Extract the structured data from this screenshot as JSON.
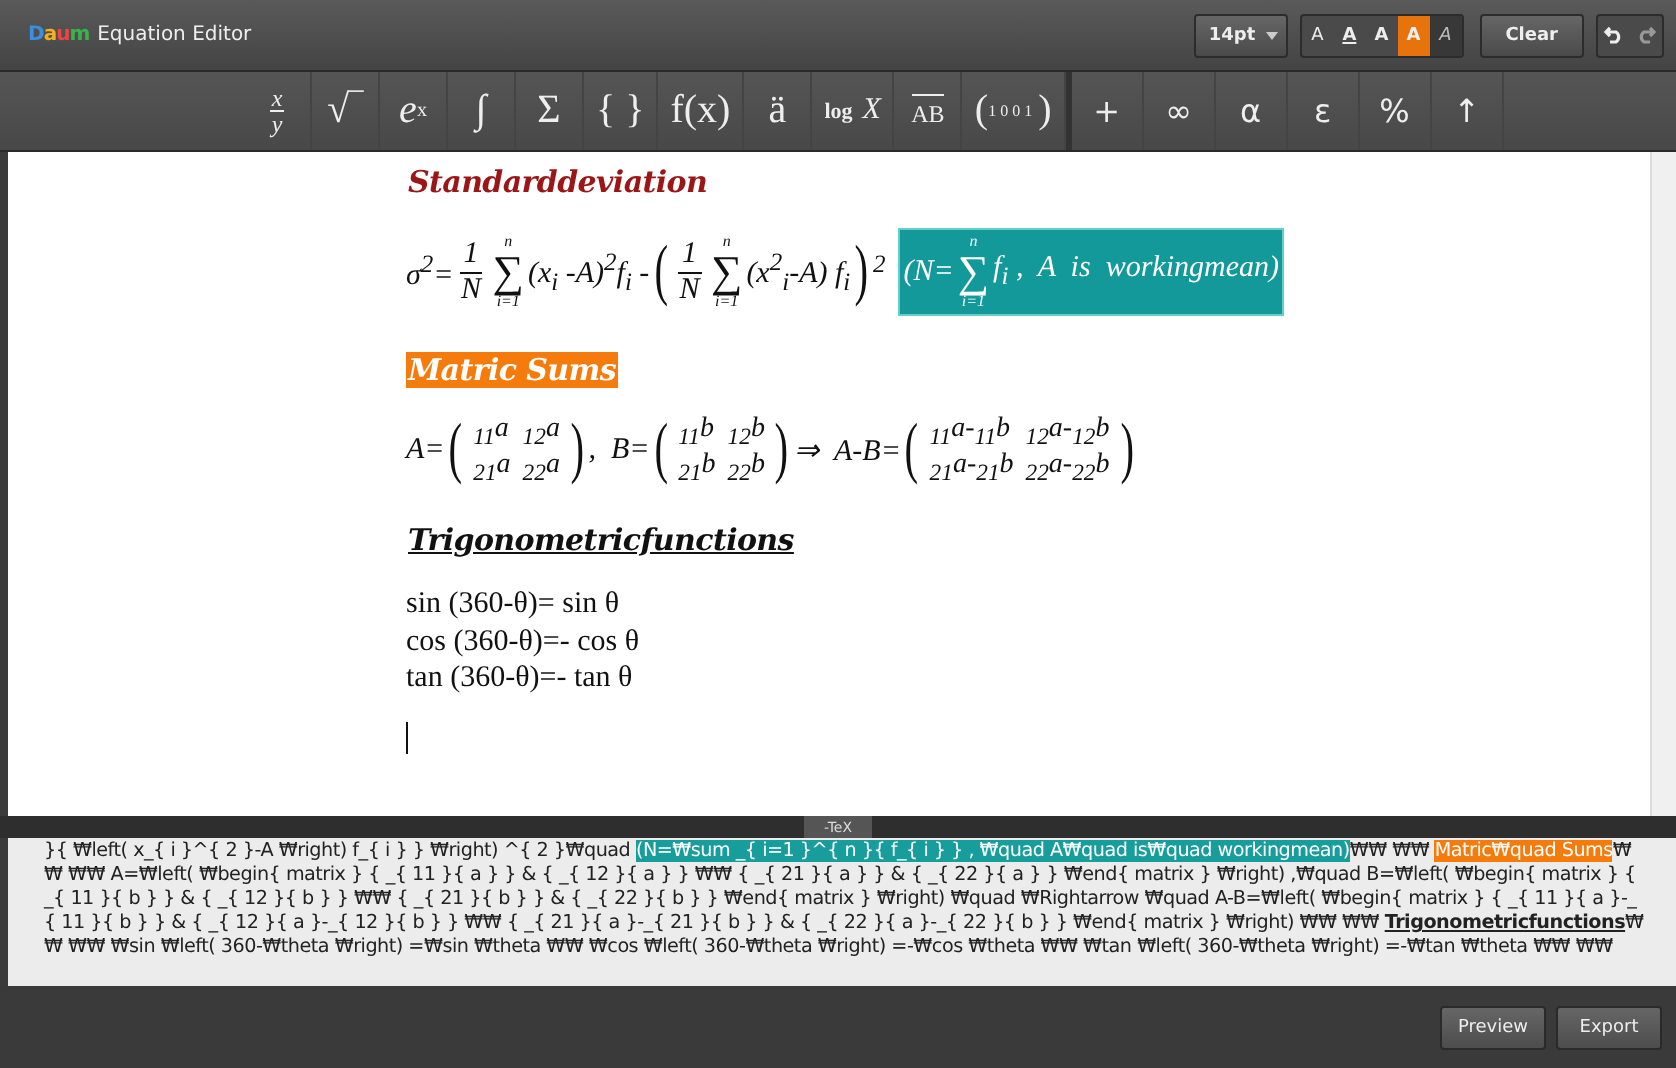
{
  "app": {
    "logo": "Daum",
    "title": "Equation Editor"
  },
  "font_size": {
    "value": "14pt"
  },
  "format_buttons": [
    {
      "label": "A",
      "kind": "plain",
      "selected": false
    },
    {
      "label": "A",
      "kind": "underline",
      "selected": false
    },
    {
      "label": "A",
      "kind": "bold",
      "selected": false
    },
    {
      "label": "A",
      "kind": "highlight",
      "selected": false
    },
    {
      "label": "A",
      "kind": "italic",
      "selected": true
    }
  ],
  "clear_button": "Clear",
  "history": [
    {
      "kind": "undo",
      "disabled": false
    },
    {
      "kind": "redo",
      "disabled": true
    }
  ],
  "structure_tools": [
    {
      "kind": "frac",
      "num": "x",
      "den": "y"
    },
    {
      "kind": "text",
      "label": "√‾"
    },
    {
      "kind": "sup",
      "base": "e",
      "sup": "x"
    },
    {
      "kind": "text",
      "label": "∫"
    },
    {
      "kind": "text",
      "label": "Σ"
    },
    {
      "kind": "text",
      "label": "{ }"
    },
    {
      "kind": "text",
      "label": "f(x)"
    },
    {
      "kind": "text",
      "label": "ä"
    },
    {
      "kind": "log",
      "fn": "log",
      "arg": "X"
    },
    {
      "kind": "vec",
      "label": "AB"
    },
    {
      "kind": "matrix",
      "open": "(",
      "close": ")",
      "rows": [
        [
          "1",
          "0"
        ],
        [
          "0",
          "1"
        ]
      ]
    }
  ],
  "symbol_tools": [
    "+",
    "∞",
    "α",
    "ε",
    "%",
    "↑"
  ],
  "document": [
    {
      "kind": "title",
      "text": "Standarddeviation"
    },
    {
      "kind": "formula",
      "tokens": [
        {
          "kind": "text",
          "text": "σ$^{2}$="
        },
        {
          "kind": "frac",
          "num": "1",
          "den": "N"
        },
        {
          "kind": "sum",
          "sign": "∑",
          "top": "n",
          "bottom": "i=1"
        },
        {
          "kind": "text",
          "text": "(x$_{i}$ -A)$^{2}$f$_{i}$ -"
        },
        {
          "kind": "big",
          "text": "("
        },
        {
          "kind": "frac",
          "num": "1",
          "den": "N"
        },
        {
          "kind": "sum",
          "sign": "∑",
          "top": "n",
          "bottom": "i=1"
        },
        {
          "kind": "text",
          "text": "(x$^{2}$$_{i}$-A) f$_{i}$"
        },
        {
          "kind": "big",
          "text": ")"
        },
        {
          "kind": "text",
          "text": "$^{2}$"
        },
        {
          "kind": "box",
          "tokens": [
            {
              "kind": "text",
              "text": "(N="
            },
            {
              "kind": "sum",
              "sign": "∑",
              "top": "n",
              "bottom": "i=1"
            },
            {
              "kind": "text",
              "text": "f$_{i}$ ,  A  is  workingmean)"
            }
          ]
        }
      ]
    },
    {
      "kind": "marked",
      "text": "Matric  Sums"
    },
    {
      "kind": "formula",
      "tokens": [
        {
          "kind": "text",
          "text": "A="
        },
        {
          "kind": "matrix",
          "open": "(",
          "close": ")",
          "rows": [
            [
              "$_{11}$a",
              "$_{12}$a"
            ],
            [
              "$_{21}$a",
              "$_{22}$a"
            ]
          ]
        },
        {
          "kind": "text",
          "text": ",  B="
        },
        {
          "kind": "matrix",
          "open": "(",
          "close": ")",
          "rows": [
            [
              "$_{11}$b",
              "$_{12}$b"
            ],
            [
              "$_{21}$b",
              "$_{22}$b"
            ]
          ]
        },
        {
          "kind": "text",
          "text": "⇒  A-B="
        },
        {
          "kind": "matrix",
          "open": "(",
          "close": ")",
          "rows": [
            [
              "$_{11}$a-$_{11}$b",
              "$_{12}$a-$_{12}$b"
            ],
            [
              "$_{21}$a-$_{21}$b",
              "$_{22}$a-$_{22}$b"
            ]
          ]
        }
      ]
    },
    {
      "kind": "underlined",
      "text": "Trigonometricfunctions"
    },
    {
      "kind": "lines",
      "lines": [
        "sin (360-θ)= sin θ",
        "cos (360-θ)=- cos θ",
        "tan (360-θ)=- tan θ"
      ]
    }
  ],
  "tex_toggle": "-TeX",
  "tex_source": [
    {
      "kind": "plain",
      "text": "}{ ₩left( x_{ i }^{ 2 }-A ₩right) f_{ i } }  ₩right) ^{ 2 }₩quad "
    },
    {
      "kind": "boxed",
      "text": "(N=₩sum _{ i=1 }^{ n }{ f_{ i } } , ₩quad A₩quad is₩quad workingmean)"
    },
    {
      "kind": "plain",
      "text": "₩₩ ₩₩ "
    },
    {
      "kind": "marked",
      "text": "Matric₩quad Sums"
    },
    {
      "kind": "plain",
      "text": "₩₩ ₩₩ A=₩left( ₩begin{ matrix } { _{ 11 }{ a } } & { _{ 12 }{ a } } ₩₩ { _{ 21 }{ a } } & { _{ 22 }{ a } } ₩end{ matrix } ₩right) ,₩quad B=₩left( ₩begin{ matrix } { _{ 11 }{ b } } & { _{ 12 }{ b } } ₩₩ { _{ 21 }{ b } } & { _{ 22 }{ b } } ₩end{ matrix } ₩right) ₩quad ₩Rightarrow ₩quad A-B=₩left( ₩begin{ matrix } { _{ 11 }{ a }-_{ 11 }{ b } } & { _{ 12 }{ a }-_{ 12 }{ b } } ₩₩ { _{ 21 }{ a }-_{ 21 }{ b } } & { _{ 22 }{ a }-_{ 22 }{ b } } ₩end{ matrix } ₩right) ₩₩ ₩₩ "
    },
    {
      "kind": "underlined",
      "text": "Trigonometricfunctions"
    },
    {
      "kind": "plain",
      "text": "₩₩ ₩₩ ₩sin  ₩left( 360-₩theta  ₩right) =₩sin  ₩theta ₩₩ ₩cos  ₩left( 360-₩theta  ₩right) =-₩cos  ₩theta ₩₩ ₩tan  ₩left( 360-₩theta  ₩right) =-₩tan  ₩theta ₩₩ ₩₩"
    }
  ],
  "footer_buttons": [
    "Preview",
    "Export"
  ]
}
